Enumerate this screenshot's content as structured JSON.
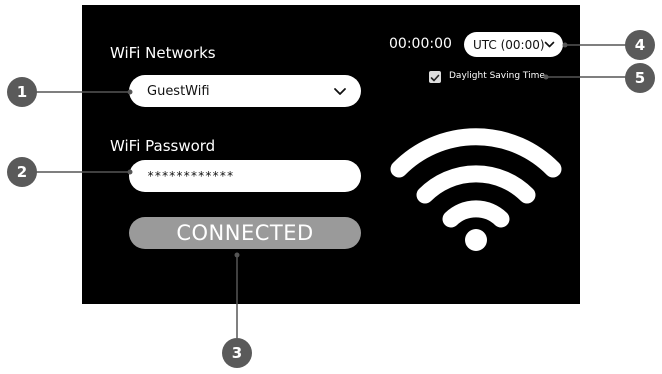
{
  "wifi": {
    "networks_label": "WiFi Networks",
    "selected_network": "GuestWifi",
    "password_label": "WiFi Password",
    "password_value": "************",
    "connect_label": "CONNECTED"
  },
  "time": {
    "clock": "00:00:00",
    "timezone": "UTC (00:00)",
    "dst_label": "Daylight Saving Time",
    "dst_checked": true
  },
  "callouts": [
    "1",
    "2",
    "3",
    "4",
    "5"
  ],
  "icons": {
    "network_chevron": "chevron-down-icon",
    "timezone_chevron": "chevron-down-icon",
    "dst_check": "check-icon",
    "wifi_signal": "wifi-icon"
  },
  "colors": {
    "screen_bg": "#000000",
    "field_bg": "#ffffff",
    "button_bg": "#9a9a9a",
    "callout_bg": "#5a5a5a"
  }
}
